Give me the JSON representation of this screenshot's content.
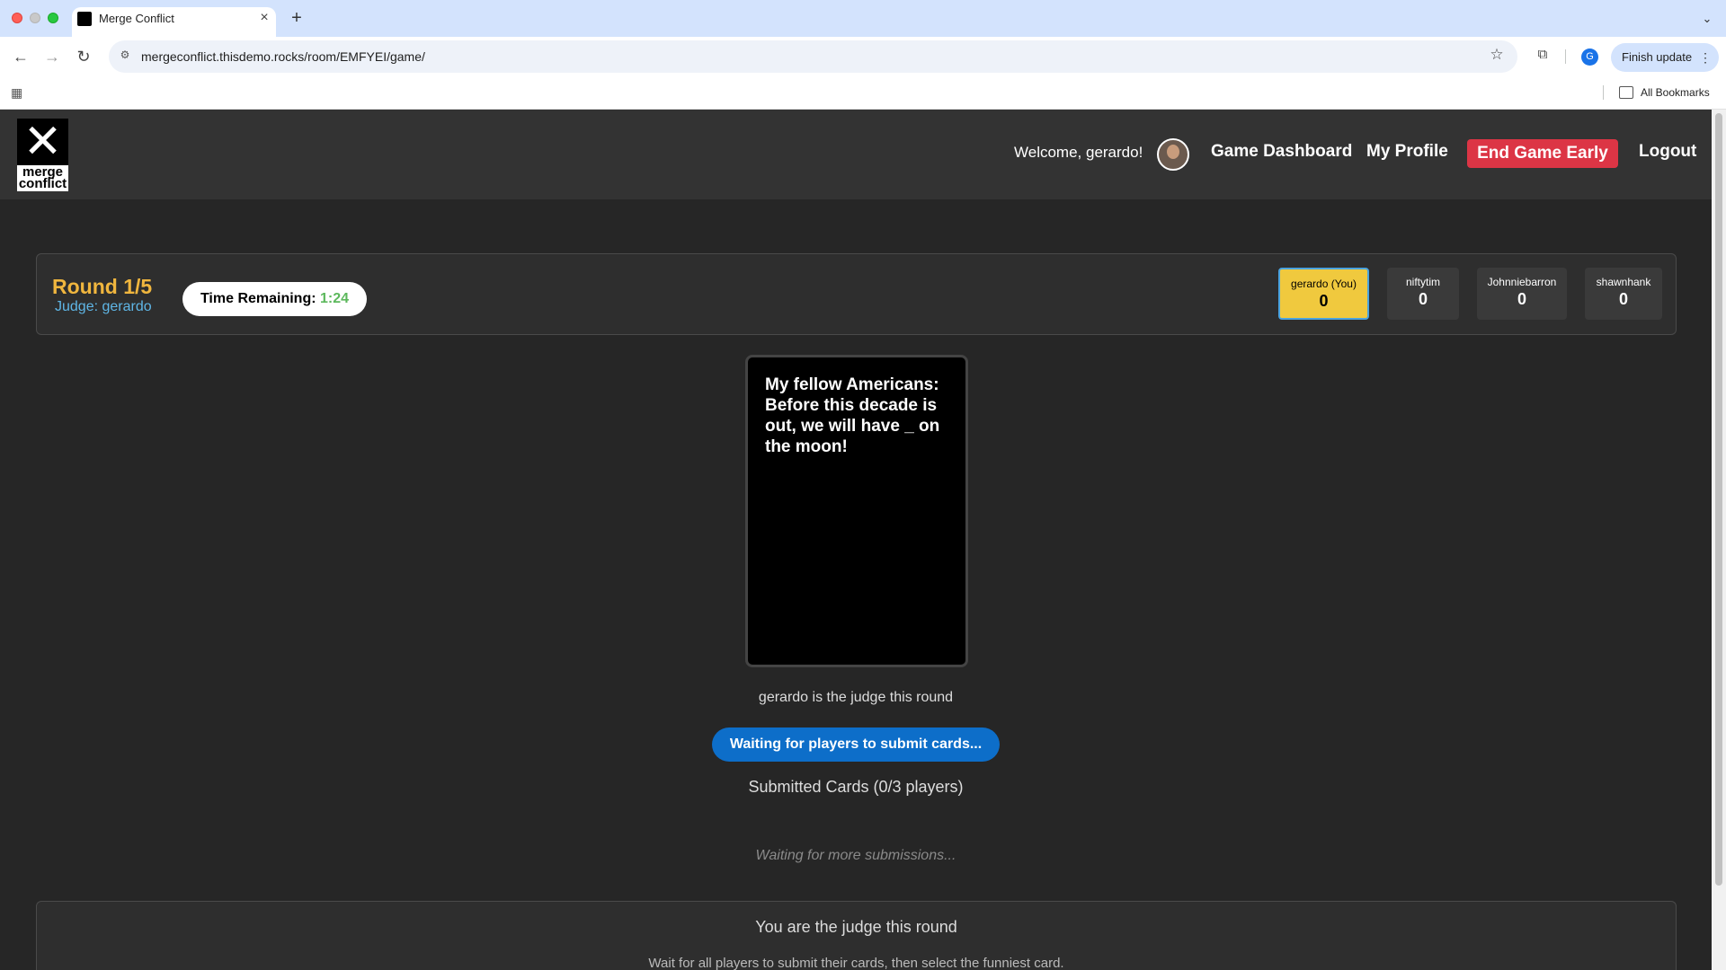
{
  "browser": {
    "tab_title": "Merge Conflict",
    "url": "mergeconflict.thisdemo.rocks/room/EMFYEI/game/",
    "profile_initial": "G",
    "finish_update_label": "Finish update",
    "bookmarks_label": "All Bookmarks"
  },
  "header": {
    "logo_text": "merge conflict",
    "welcome": "Welcome, gerardo!",
    "nav": {
      "dashboard": "Game Dashboard",
      "profile": "My Profile",
      "end_game": "End Game Early",
      "logout": "Logout"
    }
  },
  "round": {
    "title": "Round 1/5",
    "judge": "Judge: gerardo",
    "timer_label": "Time Remaining:",
    "timer_value": "1:24"
  },
  "players": [
    {
      "name": "gerardo (You)",
      "score": "0"
    },
    {
      "name": "niftytim",
      "score": "0"
    },
    {
      "name": "Johnniebarron",
      "score": "0"
    },
    {
      "name": "shawnhank",
      "score": "0"
    }
  ],
  "prompt_card": {
    "text": "My fellow Americans: Before this decade is out, we will have _ on the moon!"
  },
  "status": {
    "judge_info": "gerardo is the judge this round",
    "waiting_button": "Waiting for players to submit cards...",
    "submitted": "Submitted Cards (0/3 players)",
    "waiting_more": "Waiting for more submissions..."
  },
  "judge_panel": {
    "title": "You are the judge this round",
    "subtitle": "Wait for all players to submit their cards, then select the funniest card."
  },
  "colors": {
    "accent_yellow": "#f0b63e",
    "judge_blue": "#5fb6e6",
    "end_red": "#dc3545",
    "wait_blue": "#0d6ec9",
    "timer_green": "#5cb85c"
  }
}
